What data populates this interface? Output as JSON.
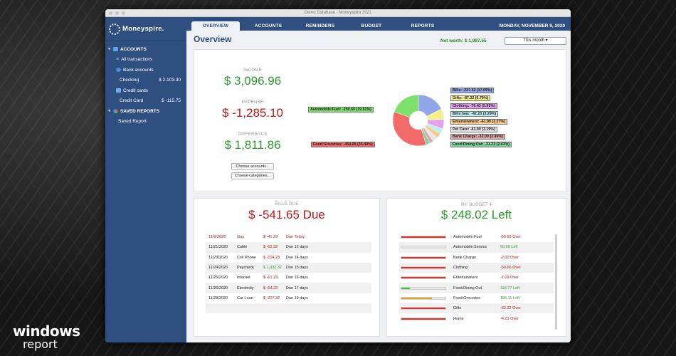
{
  "window_title": "Demo Database - Moneyspire 2021",
  "app_name": "Moneyspire.",
  "sidebar": {
    "accounts_header": "ACCOUNTS",
    "all_transactions": "All transactions",
    "bank_accounts": "Bank accounts",
    "checking_label": "Checking",
    "checking_amount": "$ 2,103.30",
    "credit_cards": "Credit cards",
    "credit_card_label": "Credit Card",
    "credit_card_amount": "$ -115.75",
    "saved_reports_header": "SAVED REPORTS",
    "saved_report": "Saved Report"
  },
  "tabs": [
    "OVERVIEW",
    "ACCOUNTS",
    "REMINDERS",
    "BUDGET",
    "REPORTS"
  ],
  "date": "MONDAY, NOVEMBER 9, 2020",
  "page_title": "Overview",
  "net_worth": "Net worth: $ 1,987.55",
  "period_select": "This month ▾",
  "summary": {
    "income_label": "INCOME",
    "income_value": "$ 3,096.96",
    "expense_label": "EXPENSE",
    "expense_value": "$ -1,285.10",
    "difference_label": "DIFFERENCE",
    "difference_value": "$ 1,811.86",
    "choose_accounts": "Choose accounts...",
    "choose_categories": "Choose categories..."
  },
  "pie_slices": [
    {
      "label": "Bills: -227.32 (17.69%)",
      "pct": 17.69,
      "color": "#8fa6e8"
    },
    {
      "label": "Gifts: -87.32 (6.79%)",
      "pct": 6.79,
      "color": "#f5f08a"
    },
    {
      "label": "Clothing: -76.43 (5.95%)",
      "pct": 5.95,
      "color": "#e7a0f0"
    },
    {
      "label": "Bills:Gas: -42.23 (3.29%)",
      "pct": 3.29,
      "color": "#b8f0f5"
    },
    {
      "label": "Entertainment: -41.99 (3.27%)",
      "pct": 3.27,
      "color": "#f7c98a"
    },
    {
      "label": "Pet Care: -41.00 (3.19%)",
      "pct": 3.19,
      "color": "#e8e8e8"
    },
    {
      "label": "Bank Charge: -32.00 (2.49%)",
      "pct": 2.49,
      "color": "#e0a5a5"
    },
    {
      "label": "Food:Dining Out: -31.23 (2.43%)",
      "pct": 2.43,
      "color": "#7fd69a"
    },
    {
      "label": "Food:Groceries: -454.89 (35.40%)",
      "pct": 35.4,
      "color": "#f26a6a"
    },
    {
      "label": "Automobile:Fuel: -250.69 (19.51%)",
      "pct": 19.51,
      "color": "#7ce06a"
    }
  ],
  "bills": {
    "label": "BILLS DUE",
    "total": "$ -541.65 Due",
    "rows": [
      {
        "date": "11/9/2020",
        "name": "Gas",
        "amount": "$ -41.23",
        "status": "Due Today",
        "type": "today"
      },
      {
        "date": "11/21/2020",
        "name": "Cable",
        "amount": "$ -62.32",
        "status": "Due 12 days",
        "type": "expense"
      },
      {
        "date": "11/23/2020",
        "name": "Cell Phone",
        "amount": "$ -104.23",
        "status": "Due 14 days",
        "type": "expense"
      },
      {
        "date": "11/24/2020",
        "name": "Paycheck",
        "amount": "$ 1,032.32",
        "status": "Due 15 days",
        "type": "income"
      },
      {
        "date": "11/25/2020",
        "name": "Internet",
        "amount": "$ -61.23",
        "status": "Due 16 days",
        "type": "expense"
      },
      {
        "date": "11/26/2020",
        "name": "Electricity",
        "amount": "$ -64.23",
        "status": "Due 17 days",
        "type": "expense"
      },
      {
        "date": "11/28/2020",
        "name": "Car Loan",
        "amount": "$ -227.32",
        "status": "Due 19 days",
        "type": "expense"
      }
    ]
  },
  "budget": {
    "label": "MY BUDGET ▾",
    "total": "$ 248.02 Left",
    "rows": [
      {
        "name": "Automobile:Fuel",
        "value": "-50.69 Over",
        "state": "over",
        "fill": 1.0
      },
      {
        "name": "Automobile:Service",
        "value": "50.00 Left",
        "state": "left",
        "fill": 0.0
      },
      {
        "name": "Bank Charge",
        "value": "-2.00 Over",
        "state": "over",
        "fill": 1.0
      },
      {
        "name": "Clothing",
        "value": "-59.66 Over",
        "state": "over",
        "fill": 1.0
      },
      {
        "name": "Entertainment",
        "value": "-7.09 Over",
        "state": "over",
        "fill": 1.0
      },
      {
        "name": "Food:Dining Out",
        "value": "118.77 Left",
        "state": "left",
        "fill": 0.2
      },
      {
        "name": "Food:Groceries",
        "value": "195.11 Left",
        "state": "partial",
        "fill": 0.7
      },
      {
        "name": "Gifts",
        "value": "-62.32 Over",
        "state": "over",
        "fill": 1.0
      },
      {
        "name": "Home",
        "value": "-4.23 Over",
        "state": "over",
        "fill": 1.0
      }
    ]
  },
  "colors": {
    "accent": "#2e4f7f",
    "income_green": "#2a9a2a",
    "expense_red": "#b81818",
    "bar_red": "#d9342b",
    "bar_green": "#2ecc40",
    "bar_orange": "#e8a026"
  },
  "watermark": {
    "line1": "windows",
    "line2": "report"
  }
}
